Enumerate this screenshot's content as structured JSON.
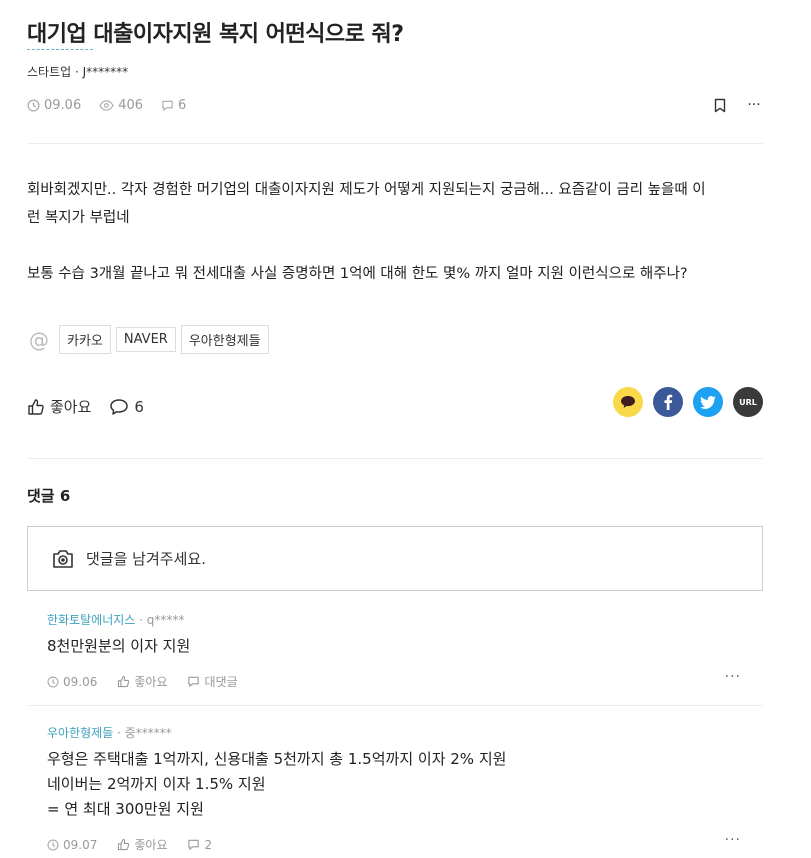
{
  "post": {
    "title": "대기업 대출이자지원 복지 어떤식으로 줘?",
    "author": "스타트업 · J*******",
    "date": "09.06",
    "views": "406",
    "comments_count": "6",
    "body": [
      "회바회겠지만.. 각자 경험한 머기업의 대출이자지원 제도가 어떻게 지원되는지 궁금해... 요즘같이 금리 높을때 이",
      "런 복지가 부럽네",
      "보통 수습 3개월 끝나고 뭐 전세대출 사실 증명하면 1억에 대해 한도 몇% 까지 얼마 지원 이런식으로 해주나?"
    ],
    "tags": [
      "카카오",
      "NAVER",
      "우아한형제들"
    ],
    "like_label": "좋아요",
    "comment_count_label": "6"
  },
  "share": {
    "url_label": "URL",
    "colors": {
      "kakao": "#f9d84a",
      "facebook": "#3b5998",
      "twitter": "#1da1f2",
      "url": "#3a3a3a"
    }
  },
  "comments_section": {
    "title": "댓글 6",
    "input_placeholder": "댓글을 남겨주세요."
  },
  "comments": [
    {
      "company": "한화토탈에너지스",
      "user": " · q*****",
      "lines": [
        "8천만원분의 이자 지원"
      ],
      "date": "09.06",
      "like_label": "좋아요",
      "reply_label": "대댓글"
    },
    {
      "company": "우아한형제들",
      "user": " · 중******",
      "lines": [
        "우형은 주택대출 1억까지, 신용대출 5천까지 총 1.5억까지 이자 2% 지원",
        "네이버는 2억까지 이자 1.5% 지원",
        "= 연 최대 300만원 지원"
      ],
      "date": "09.07",
      "like_label": "좋아요",
      "reply_label": "2"
    }
  ],
  "ui": {
    "more": "···"
  }
}
